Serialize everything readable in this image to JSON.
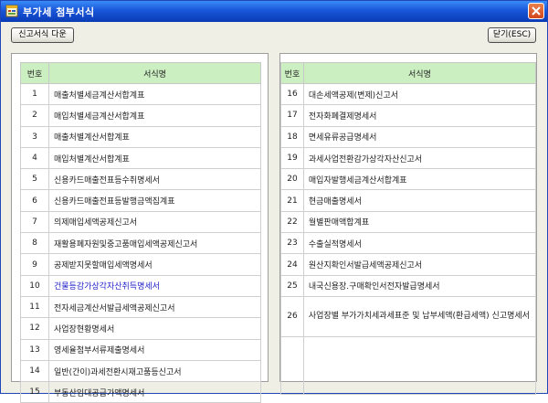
{
  "window": {
    "title": "부가세 첨부서식",
    "colors": {
      "titlebar": "#1956d8",
      "header_bg": "#ccefc2",
      "link": "#2222c8"
    }
  },
  "toolbar": {
    "download_label": "신고서식 다운",
    "close_label": "닫기(ESC)"
  },
  "table_headers": {
    "num": "번호",
    "name": "서식명"
  },
  "left_table": [
    {
      "num": "1",
      "name": "매출처별세금계산서합계표"
    },
    {
      "num": "2",
      "name": "매입처별세금계산서합계표"
    },
    {
      "num": "3",
      "name": "매출처별계산서합계표"
    },
    {
      "num": "4",
      "name": "매입처별계산서합계표"
    },
    {
      "num": "5",
      "name": "신용카드매출전표등수취명세서"
    },
    {
      "num": "6",
      "name": "신용카드매출전표등발행금액집계표"
    },
    {
      "num": "7",
      "name": "의제매입세액공제신고서"
    },
    {
      "num": "8",
      "name": "재활용폐자원및중고품매입세액공제신고서"
    },
    {
      "num": "9",
      "name": "공제받지못할매입세액명세서"
    },
    {
      "num": "10",
      "name": "건물등감가상각자산취득명세서"
    },
    {
      "num": "11",
      "name": "전자세금계산서발급세액공제신고서"
    },
    {
      "num": "12",
      "name": "사업장현황명세서"
    },
    {
      "num": "13",
      "name": "영세율첨부서류제출명세서"
    },
    {
      "num": "14",
      "name": "일반(간이)과세전환시재고품등신고서"
    },
    {
      "num": "15",
      "name": "부동산임대공급가액명세서"
    }
  ],
  "right_table": [
    {
      "num": "16",
      "name": "대손세액공제(변제)신고서"
    },
    {
      "num": "17",
      "name": "전자화폐결제명세서"
    },
    {
      "num": "18",
      "name": "면세유류공급명세서"
    },
    {
      "num": "19",
      "name": "과세사업전환감가상각자산신고서"
    },
    {
      "num": "20",
      "name": "매입자발행세금계산서합계표"
    },
    {
      "num": "21",
      "name": "현금매출명세서"
    },
    {
      "num": "22",
      "name": "월별판매액합계표"
    },
    {
      "num": "23",
      "name": "수출실적명세서"
    },
    {
      "num": "24",
      "name": "원산지확인서발급세액공제신고서"
    },
    {
      "num": "25",
      "name": "내국신용장.구매확인서전자발급명세서"
    },
    {
      "num": "26",
      "name": "사업장별 부가가치세과세표준 및 납부세액(환급세액) 신고명세서"
    }
  ]
}
